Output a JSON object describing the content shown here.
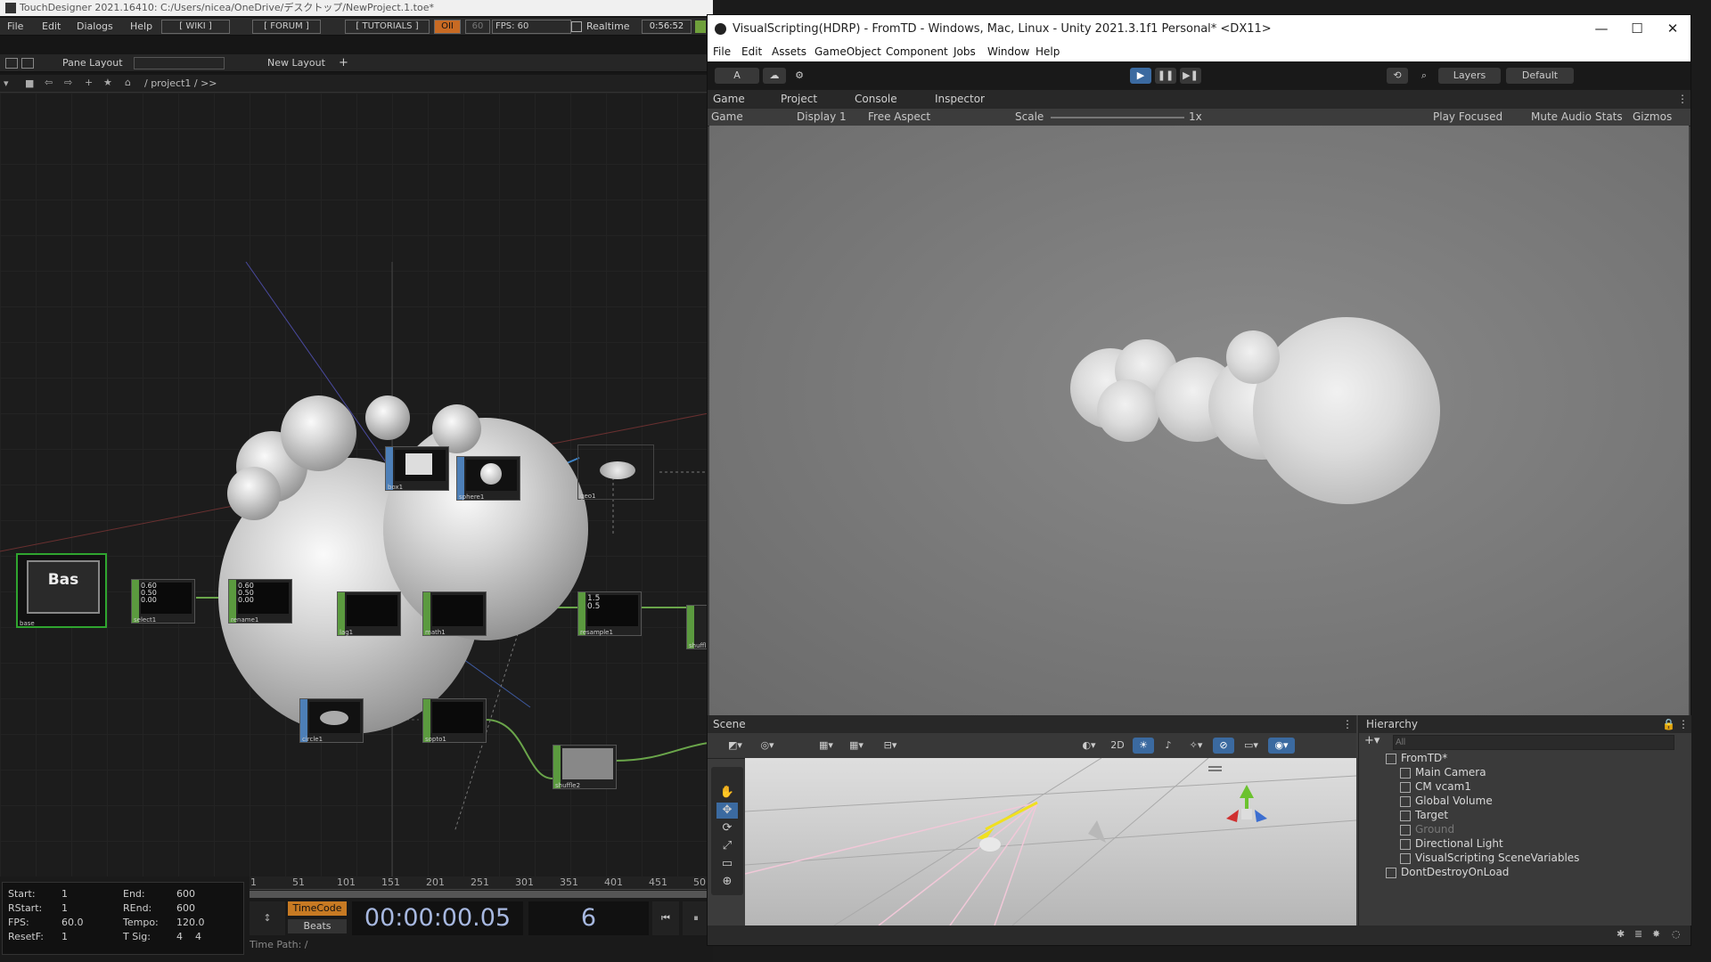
{
  "touchdesigner": {
    "title": "TouchDesigner 2021.16410: C:/Users/nicea/OneDrive/デスクトップ/NewProject.1.toe*",
    "menu": [
      "File",
      "Edit",
      "Dialogs",
      "Help"
    ],
    "links": [
      "[ WIKI ]",
      "[ FORUM ]",
      "[ TUTORIALS ]"
    ],
    "oii": "OII",
    "fps_target": "60",
    "fps_label": "FPS: 60",
    "realtime": "Realtime",
    "clock": "0:56:52",
    "pane_layout": "Pane Layout",
    "new_layout": "New Layout",
    "path": "/ project1 / >>",
    "nodes": {
      "bas": "Bas",
      "bas_label": "base",
      "select1": "select1",
      "rename1": "rename1",
      "lag1": "lag1",
      "math1": "math1",
      "resample1": "resample1",
      "shuffle": "shuffl",
      "box1": "box1",
      "sphere1": "sphere1",
      "geo1": "geo1",
      "circle1": "circle1",
      "soptoCHOP": "sopto1",
      "shuffle2": "shuffle2",
      "select_viz": "0.60\n0.50\n0.00",
      "rename_viz": "0.60\n0.50\n0.00",
      "resample_viz": "1.5\n0.5"
    },
    "ruler": [
      "1",
      "51",
      "101",
      "151",
      "201",
      "251",
      "301",
      "351",
      "401",
      "451",
      "50"
    ],
    "stats": {
      "start_label": "Start:",
      "start": "1",
      "end_label": "End:",
      "end": "600",
      "rstart_label": "RStart:",
      "rstart": "1",
      "rend_label": "REnd:",
      "rend": "600",
      "fps_label": "FPS:",
      "fps": "60.0",
      "tempo_label": "Tempo:",
      "tempo": "120.0",
      "resetf_label": "ResetF:",
      "resetf": "1",
      "tsig_label": "T Sig:",
      "tsig": "4    4"
    },
    "timecode_label": "TimeCode",
    "beats_label": "Beats",
    "timecode": "00:00:00.05",
    "frame": "6",
    "time_path": "Time Path: /"
  },
  "unity": {
    "title": "VisualScripting(HDRP) - FromTD - Windows, Mac, Linux - Unity 2021.3.1f1 Personal* <DX11>",
    "menu": [
      "File",
      "Edit",
      "Assets",
      "GameObject",
      "Component",
      "Jobs",
      "Window",
      "Help"
    ],
    "toolbar": {
      "account": "A",
      "layers": "Layers",
      "layout": "Default"
    },
    "tabs": [
      "Game",
      "Project",
      "Console",
      "Inspector"
    ],
    "game_bar": {
      "mode": "Game",
      "display": "Display 1",
      "aspect": "Free Aspect",
      "scale_label": "Scale",
      "scale_value": "1x",
      "play_focused": "Play Focused",
      "mute": "Mute Audio",
      "stats": "Stats",
      "gizmos": "Gizmos"
    },
    "scene_tab": "Scene",
    "scene_2d": "2D",
    "hierarchy": {
      "tab": "Hierarchy",
      "search_placeholder": "All",
      "items": [
        {
          "label": "FromTD*",
          "level": 0
        },
        {
          "label": "Main Camera",
          "level": 1
        },
        {
          "label": "CM vcam1",
          "level": 1
        },
        {
          "label": "Global Volume",
          "level": 1
        },
        {
          "label": "Target",
          "level": 1
        },
        {
          "label": "Ground",
          "level": 1
        },
        {
          "label": "Directional Light",
          "level": 1
        },
        {
          "label": "VisualScripting SceneVariables",
          "level": 1
        },
        {
          "label": "DontDestroyOnLoad",
          "level": 0
        }
      ]
    }
  }
}
